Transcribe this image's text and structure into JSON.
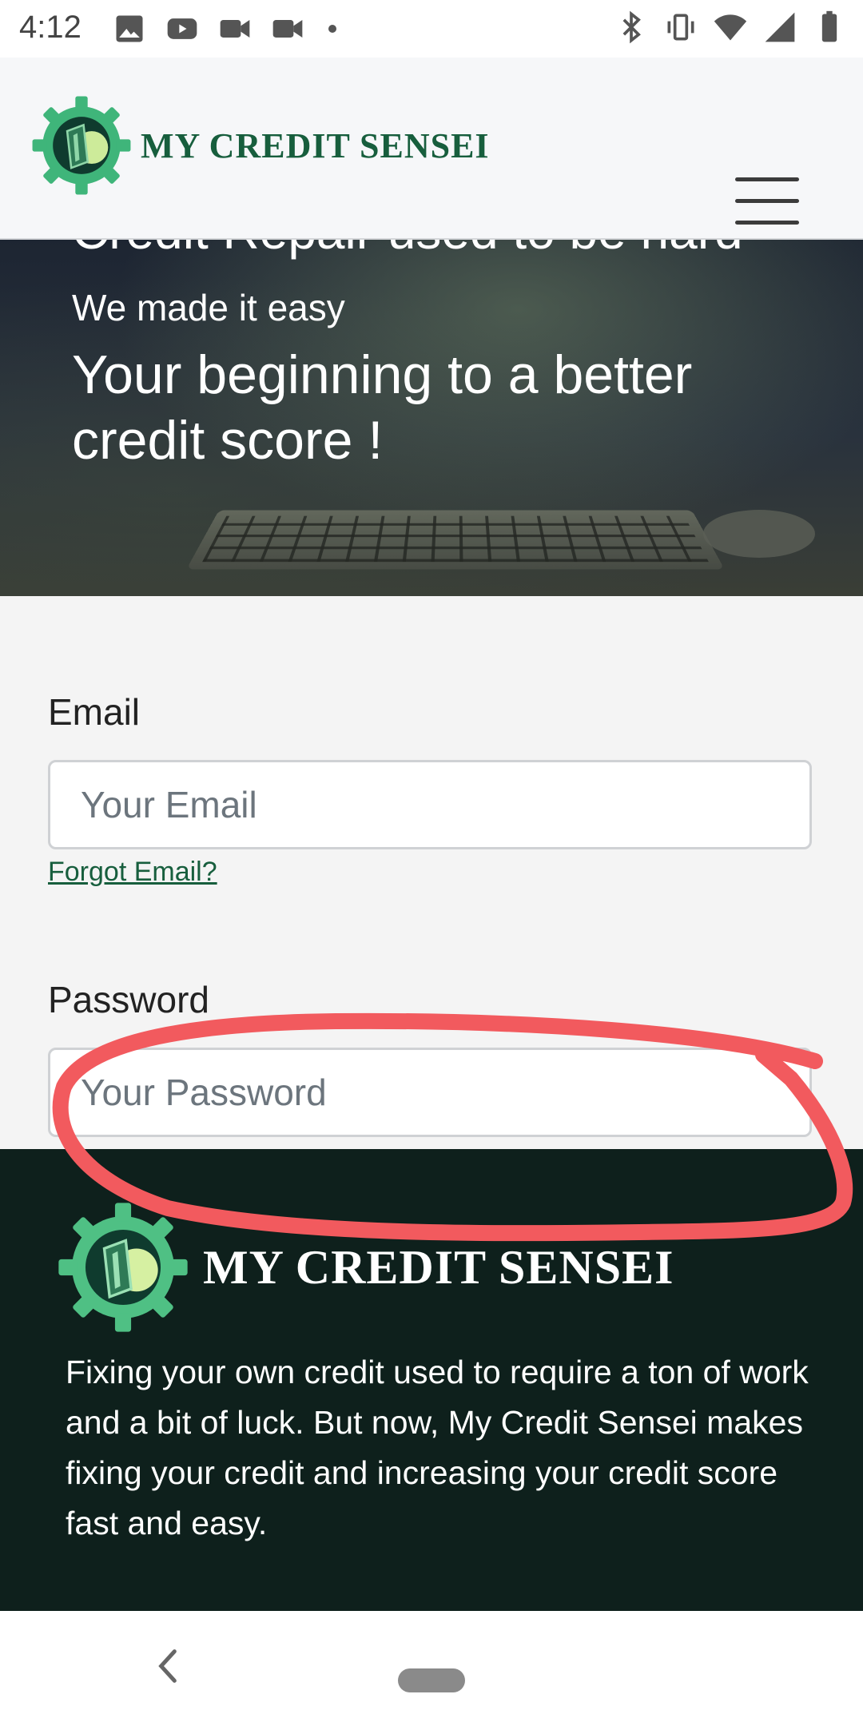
{
  "status_bar": {
    "time": "4:12",
    "left_icons": [
      "image-icon",
      "youtube-icon",
      "video-camera-icon",
      "video-camera-icon",
      "dot-icon"
    ],
    "right_icons": [
      "bluetooth-icon",
      "vibrate-icon",
      "wifi-icon",
      "cell-signal-icon",
      "battery-icon"
    ]
  },
  "header": {
    "brand_name": "MY CREDIT SENSEI",
    "menu_icon": "hamburger-icon"
  },
  "hero": {
    "cut_title": "Credit Repair used to be hard",
    "subtitle": "We made it easy",
    "headline": "Your beginning to a better credit score !"
  },
  "form": {
    "email_label": "Email",
    "email_placeholder": "Your Email",
    "forgot_email": "Forgot Email?",
    "password_label": "Password",
    "password_placeholder": "Your Password"
  },
  "footer": {
    "brand_name": "MY CREDIT SENSEI",
    "description": "Fixing your own credit used to require a ton of work and a bit of luck. But now, My Credit Sensei makes fixing your credit and increasing your credit score fast and easy."
  },
  "colors": {
    "brand_green": "#175e3d",
    "logo_green": "#4fc084",
    "footer_bg": "#0e201c",
    "annotation_red": "#f25a5e"
  }
}
